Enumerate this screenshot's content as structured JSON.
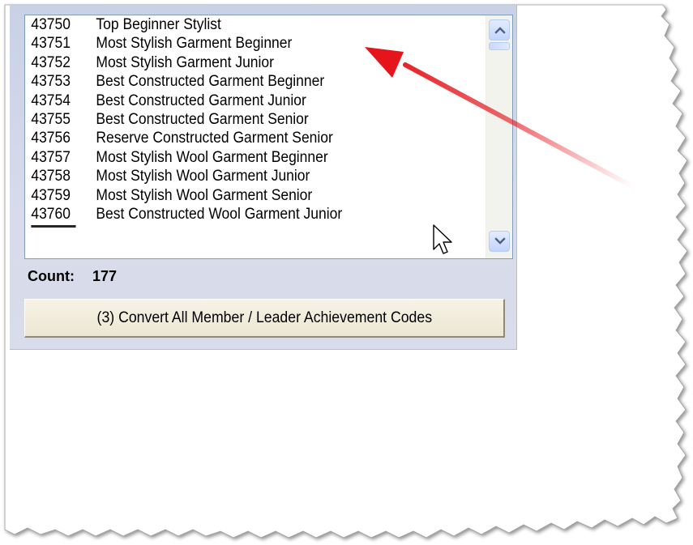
{
  "listbox": {
    "items": [
      {
        "code": "43750",
        "description": "Top Beginner Stylist"
      },
      {
        "code": "43751",
        "description": "Most Stylish Garment Beginner"
      },
      {
        "code": "43752",
        "description": "Most Stylish Garment Junior"
      },
      {
        "code": "43753",
        "description": "Best Constructed Garment Beginner"
      },
      {
        "code": "43754",
        "description": "Best Constructed Garment Junior"
      },
      {
        "code": "43755",
        "description": "Best Constructed Garment Senior"
      },
      {
        "code": "43756",
        "description": "Reserve Constructed Garment Senior"
      },
      {
        "code": "43757",
        "description": "Most Stylish Wool Garment Beginner"
      },
      {
        "code": "43758",
        "description": "Most Stylish Wool Garment Junior"
      },
      {
        "code": "43759",
        "description": "Most Stylish Wool Garment Senior"
      },
      {
        "code": "43760",
        "description": "Best Constructed Wool Garment Junior"
      }
    ],
    "scrollbar": {
      "up_icon": "chevron-up-icon",
      "down_icon": "chevron-down-icon"
    }
  },
  "count": {
    "label": "Count:",
    "value": "177"
  },
  "convert_button": {
    "label": "(3)  Convert All Member / Leader Achievement Codes"
  },
  "annotation": {
    "arrow_color": "#e5151b",
    "cursor_icon": "mouse-pointer-icon"
  },
  "colors": {
    "panel_bg": "#d7dbeb",
    "listbox_border": "#7f9db9",
    "scrollbar_button": "#c3d5fd",
    "button_bg": "#ece7d4"
  }
}
